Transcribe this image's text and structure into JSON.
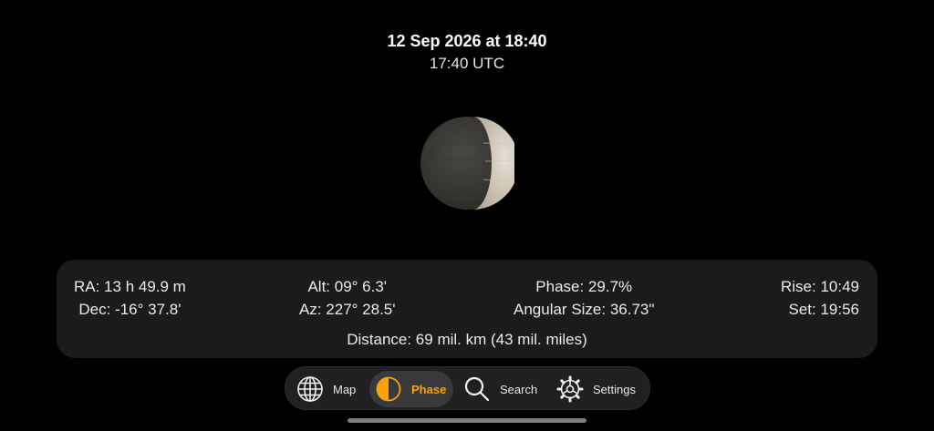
{
  "header": {
    "title": "12 Sep 2026 at 18:40",
    "subtitle": "17:40 UTC"
  },
  "planet": {
    "phase_fraction": 0.297
  },
  "info": {
    "ra": "RA: 13 h 49.9 m",
    "dec": "Dec: -16° 37.8'",
    "alt": "Alt: 09° 6.3'",
    "az": "Az: 227° 28.5'",
    "phase": "Phase: 29.7%",
    "angular_size": "Angular Size: 36.73\"",
    "rise": "Rise: 10:49",
    "set": "Set: 19:56",
    "distance": "Distance: 69 mil. km (43 mil. miles)"
  },
  "tabs": {
    "map": "Map",
    "phase": "Phase",
    "search": "Search",
    "settings": "Settings",
    "active": "phase"
  },
  "icons": {
    "map": "globe-icon",
    "phase": "half-circle-icon",
    "search": "magnifier-icon",
    "settings": "gear-icon"
  },
  "colors": {
    "accent": "#ff9f0a",
    "panel": "#1b1b1d",
    "background": "#000000"
  }
}
